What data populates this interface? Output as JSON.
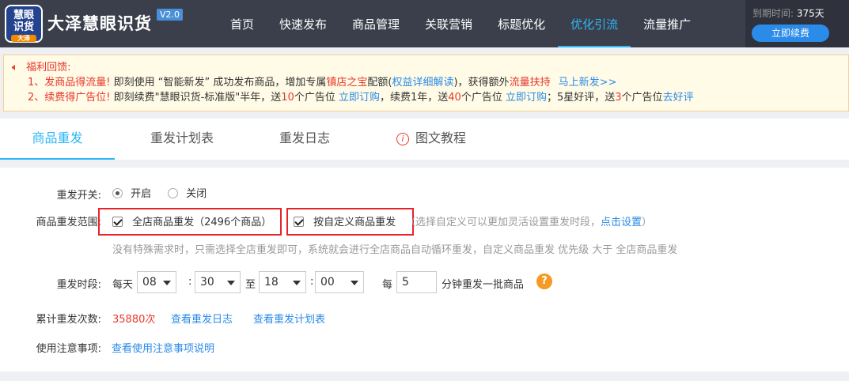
{
  "header": {
    "logo_line1": "慧眼",
    "logo_line2": "识货",
    "logo_badge": "大泽",
    "brand": "大泽慧眼识货",
    "version": "V2.0",
    "nav": [
      {
        "label": "首页",
        "active": false
      },
      {
        "label": "快速发布",
        "active": false
      },
      {
        "label": "商品管理",
        "active": false
      },
      {
        "label": "关联营销",
        "active": false
      },
      {
        "label": "标题优化",
        "active": false
      },
      {
        "label": "优化引流",
        "active": true
      },
      {
        "label": "流量推广",
        "active": false
      }
    ],
    "expire_label": "到期时间:",
    "expire_value": "375天",
    "renew_button": "立即续费"
  },
  "notice": {
    "title": "福利回馈:",
    "line1": {
      "prefix": "1、",
      "highlight": "发商品得流量!",
      "text1": " 即刻使用 “智能新发” 成功发布商品，增加专属",
      "red_word": "镇店之宝",
      "text2": "配额(",
      "link1": "权益详细解读",
      "text3": ")，获得额外",
      "red_word2": "流量扶持",
      "link2": "马上新发>>"
    },
    "line2": {
      "prefix": "2、",
      "highlight": "续费得广告位!",
      "text1": " 即刻续费\"慧眼识货-标准版\"半年，送",
      "num1": "10",
      "text2": "个广告位 ",
      "link1": "立即订购",
      "text3": "，续费1年，送",
      "num2": "40",
      "text4": "个广告位 ",
      "link2": "立即订购",
      "text5": "；5星好评，送",
      "num3": "3",
      "text6": "个广告位",
      "link3": "去好评"
    }
  },
  "tabs": [
    {
      "label": "商品重发",
      "active": true
    },
    {
      "label": "重发计划表",
      "active": false
    },
    {
      "label": "重发日志",
      "active": false
    },
    {
      "label": "图文教程",
      "active": false,
      "icon": "info-icon"
    }
  ],
  "form": {
    "switch_label": "重发开关:",
    "switch_on": "开启",
    "switch_off": "关闭",
    "range_label": "商品重发范围:",
    "range_all": "全店商品重发（2496个商品）",
    "range_custom": "按自定义商品重发",
    "range_hint": "（选择自定义可以更加灵活设置重发时段，",
    "range_hint_link": "点击设置",
    "range_hint_end": "）",
    "range_note": "没有特殊需求时，只需选择全店重发即可，系统就会进行全店商品自动循环重发，自定义商品重发 优先级 大于 全店商品重发",
    "time_label": "重发时段:",
    "every_day": "每天",
    "start_hour": "08",
    "start_min": "30",
    "to": "至",
    "end_hour": "18",
    "end_min": "00",
    "colon": ":",
    "every": "每",
    "interval": "5",
    "interval_suffix": "分钟重发一批商品",
    "help": "?",
    "count_label": "累计重发次数:",
    "count_value": "35880次",
    "link_log": "查看重发日志",
    "link_plan": "查看重发计划表",
    "notes_label": "使用注意事项:",
    "notes_link": "查看使用注意事项说明"
  },
  "colors": {
    "header_bg": "#3b3f4c",
    "accent": "#2db7f5",
    "link": "#2b8be8",
    "red": "#e8382e",
    "notice_bg": "#fffbe6"
  }
}
